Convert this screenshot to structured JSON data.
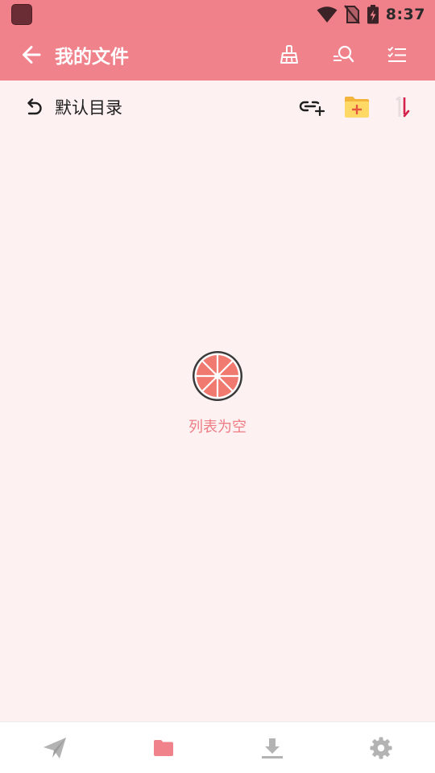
{
  "status_bar": {
    "time": "8:37",
    "icons": [
      "app-notification-icon",
      "wifi-icon",
      "no-sim-icon",
      "battery-charging-icon"
    ]
  },
  "app_bar": {
    "title": "我的文件",
    "actions": [
      "broom-clean-icon",
      "search-icon",
      "checklist-icon"
    ]
  },
  "directory": {
    "title": "默认目录",
    "actions": [
      "link-add-icon",
      "folder-add-icon",
      "sort-icon"
    ]
  },
  "empty_state": {
    "icon": "grapefruit-icon",
    "text": "列表为空"
  },
  "bottom_nav": {
    "items": [
      {
        "icon": "send-icon",
        "active": false
      },
      {
        "icon": "folder-icon",
        "active": true
      },
      {
        "icon": "download-icon",
        "active": false
      },
      {
        "icon": "gear-icon",
        "active": false
      }
    ],
    "active_color": "#f0828c",
    "inactive_color": "#b3b3b3"
  },
  "colors": {
    "primary": "#f0828c",
    "background": "#fdf1f1",
    "empty_text": "#ee7d86"
  }
}
